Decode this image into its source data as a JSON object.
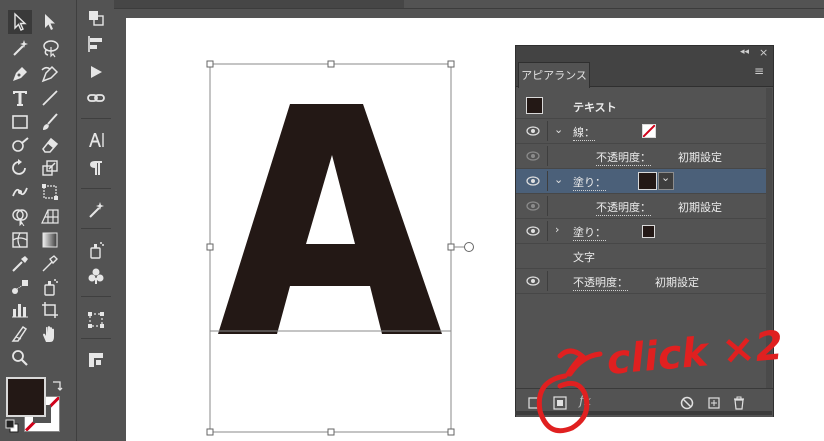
{
  "panel": {
    "tab_label": "アピアランス",
    "title_row": "テキスト",
    "rows": [
      {
        "label": "線：",
        "opacity_label": "不透明度：",
        "opacity_value": "初期設定"
      },
      {
        "label": "塗り：",
        "opacity_label": "不透明度：",
        "opacity_value": "初期設定"
      },
      {
        "label": "塗り："
      },
      {
        "label": "文字"
      },
      {
        "label": "不透明度：",
        "value": "初期設定"
      }
    ]
  },
  "annotation": {
    "text": "click ×2",
    "color": "#e02020"
  },
  "colors": {
    "fill": "#231815",
    "stroke_none": "#d0021b",
    "ui_dark": "#535353",
    "highlight": "#4b6079"
  },
  "artwork": {
    "letter": "A"
  },
  "icons": {
    "tools": [
      "selection-icon",
      "direct-selection-icon",
      "magic-wand-icon",
      "lasso-icon",
      "pen-icon",
      "curvature-icon",
      "type-icon",
      "line-icon",
      "rectangle-icon",
      "brush-icon",
      "blob-brush-icon",
      "eraser-icon",
      "rotate-icon",
      "scale-icon",
      "warp-icon",
      "free-transform-icon",
      "shape-builder-icon",
      "perspective-icon",
      "mesh-icon",
      "gradient-icon",
      "eyedropper-icon",
      "blend-icon",
      "symbol-sprayer-icon",
      "artboard-icon",
      "graph-icon",
      "slice-icon",
      "hand-icon",
      "zoom-icon"
    ]
  }
}
